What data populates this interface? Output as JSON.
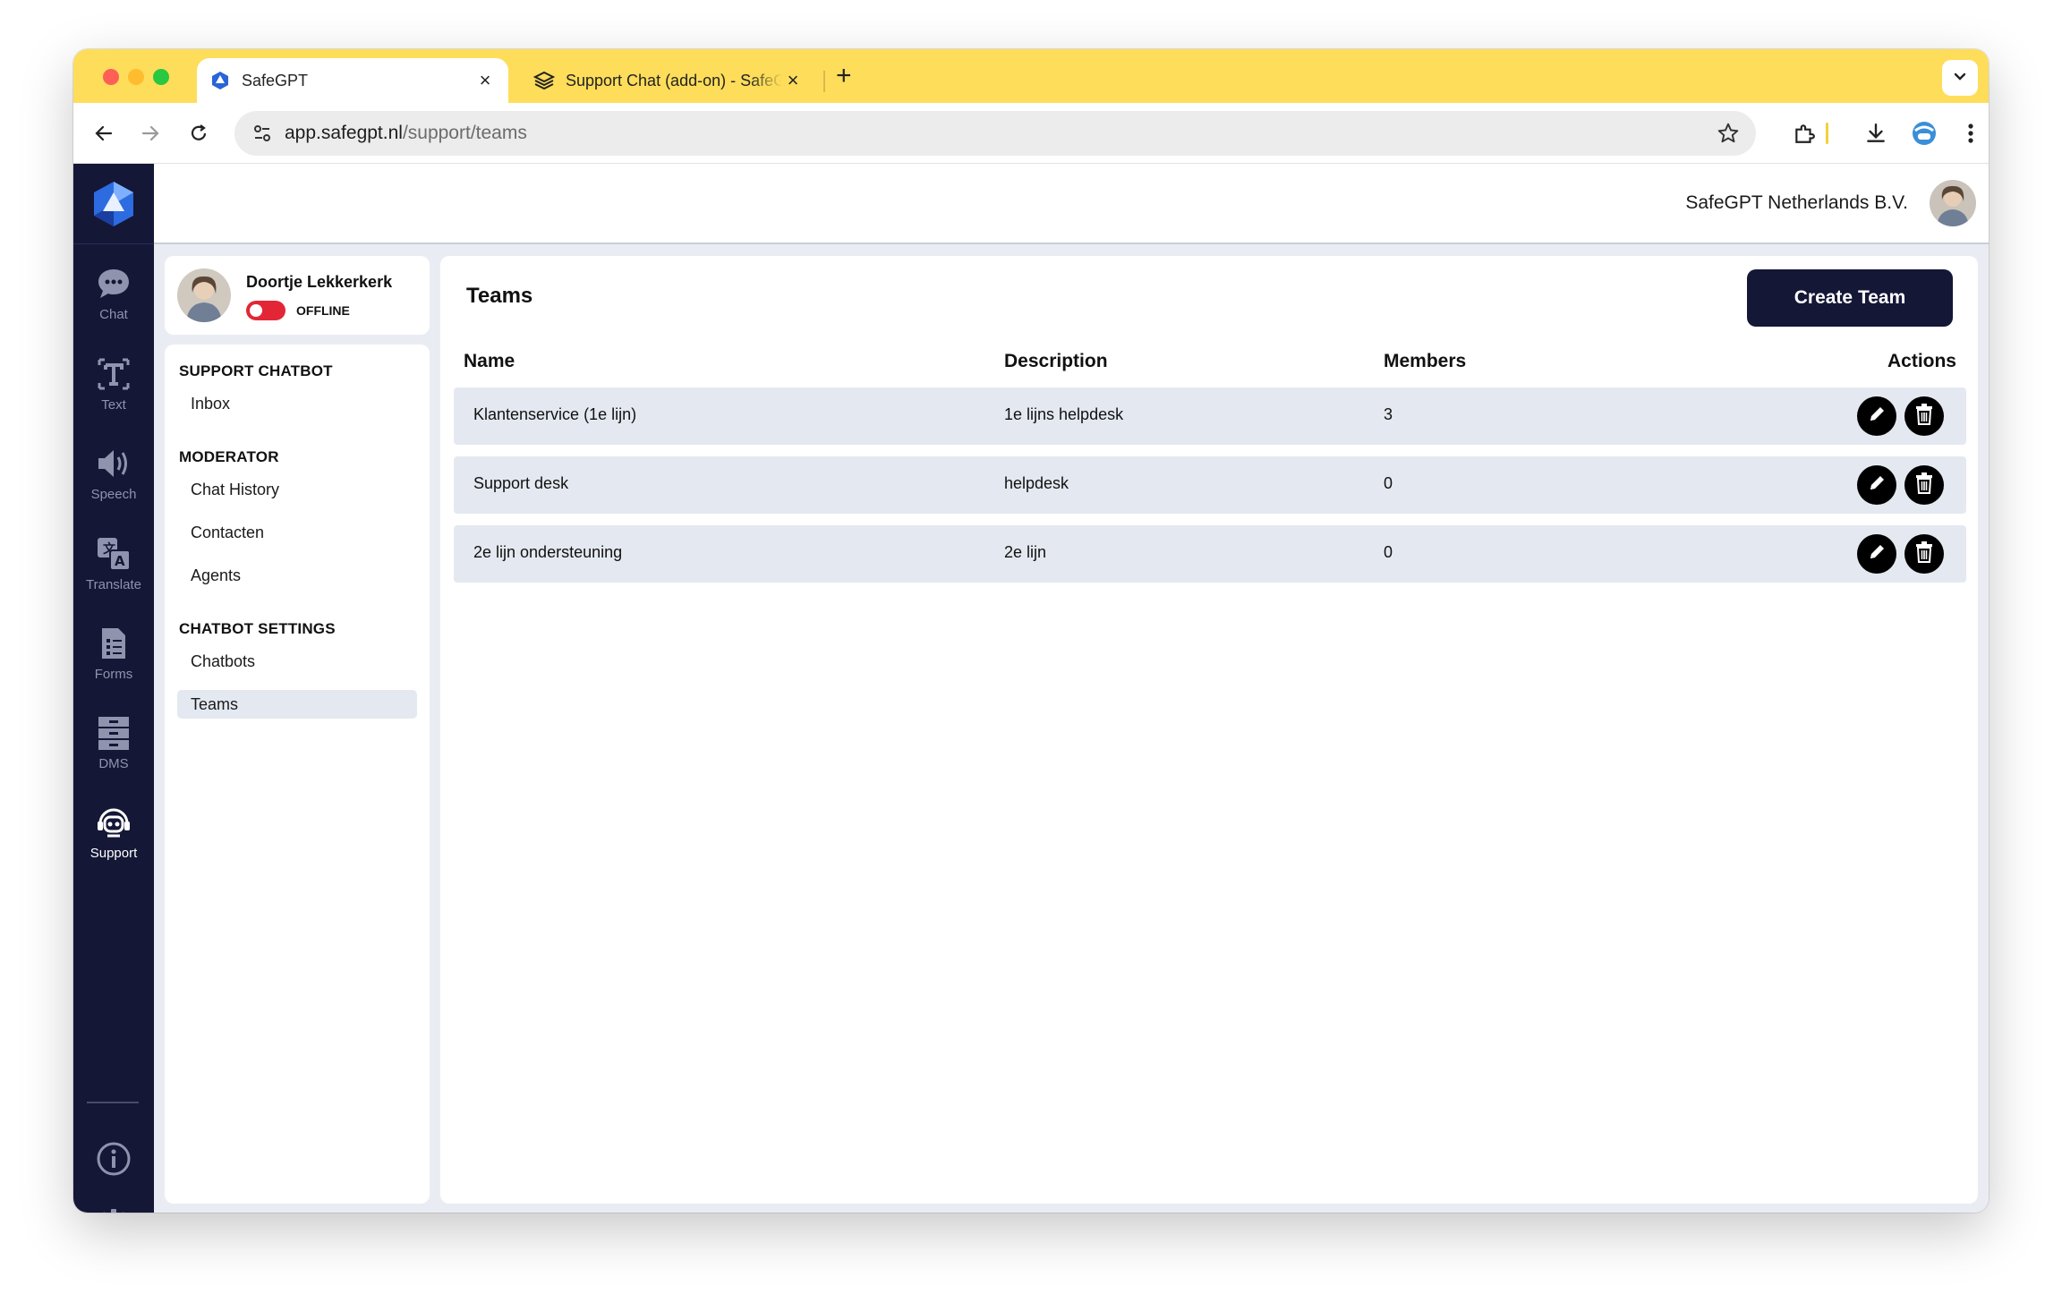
{
  "browser": {
    "tabs": [
      {
        "title": "SafeGPT",
        "favicon": "safegpt-logo-icon",
        "active": true
      },
      {
        "title": "Support Chat (add-on) - SafeGPT",
        "favicon": "stack-icon",
        "active": false
      }
    ],
    "new_tab": "+",
    "close_glyph": "×",
    "url_domain": "app.safegpt.nl",
    "url_path": "/support/teams"
  },
  "header": {
    "organization": "SafeGPT Netherlands B.V."
  },
  "rail": {
    "items": [
      {
        "label": "Chat",
        "icon": "chat-bubble-icon"
      },
      {
        "label": "Text",
        "icon": "text-icon"
      },
      {
        "label": "Speech",
        "icon": "speaker-icon"
      },
      {
        "label": "Translate",
        "icon": "translate-icon"
      },
      {
        "label": "Forms",
        "icon": "form-icon"
      },
      {
        "label": "DMS",
        "icon": "file-cabinet-icon"
      },
      {
        "label": "Support",
        "icon": "support-robot-icon",
        "active": true
      }
    ],
    "bottom_icons": [
      "info-icon",
      "gear-icon"
    ]
  },
  "user": {
    "name": "Doortje Lekkerkerk",
    "status": "OFFLINE",
    "online": false
  },
  "nav": {
    "sections": [
      {
        "title": "SUPPORT CHATBOT",
        "links": [
          "Inbox"
        ]
      },
      {
        "title": "MODERATOR",
        "links": [
          "Chat History",
          "Contacten",
          "Agents"
        ]
      },
      {
        "title": "CHATBOT SETTINGS",
        "links": [
          "Chatbots",
          "Teams"
        ]
      }
    ],
    "active_link": "Teams"
  },
  "main": {
    "title": "Teams",
    "create_button": "Create Team",
    "columns": [
      "Name",
      "Description",
      "Members",
      "Actions"
    ],
    "rows": [
      {
        "name": "Klantenservice (1e lijn)",
        "description": "1e lijns helpdesk",
        "members": "3"
      },
      {
        "name": "Support desk",
        "description": "helpdesk",
        "members": "0"
      },
      {
        "name": "2e lijn ondersteuning",
        "description": "2e lijn",
        "members": "0"
      }
    ]
  },
  "colors": {
    "tabstrip": "#fedd5a",
    "rail": "#141736",
    "row": "#e4e9f1",
    "offline_toggle": "#e32636"
  }
}
